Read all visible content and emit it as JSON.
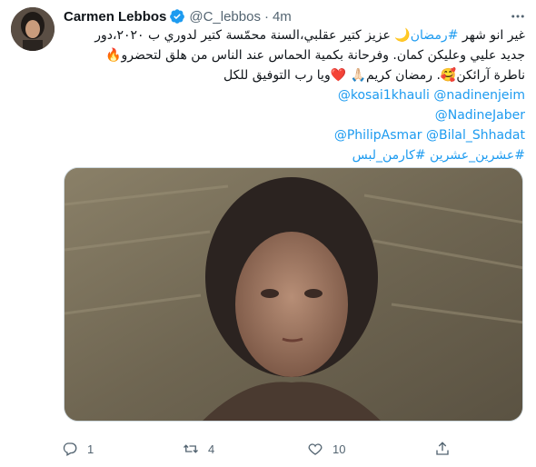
{
  "author": {
    "display_name": "Carmen Lebbos",
    "handle": "@C_lebbos",
    "separator": "·",
    "time": "4m",
    "verified_icon": "verified-badge-icon",
    "accent": "#1d9bf0"
  },
  "tweet": {
    "line1_text": "غير انو شهر ",
    "line1_hashtag": "#رمضان",
    "line1_rest": "🌙 عزيز كتير عقلبي،السنة محمّسة كتير لدوري ب ٢٠٢٠،دور",
    "line2": "جديد عليي وعليكن كمان. وفرحانة بكمية الحماس عند الناس من هلق لتحضرو🔥",
    "line3": "ناطرة آرائكن🥰. رمضان كريم🙏🏻 ❤️ويا رب التوفيق للكل",
    "mentions_line1": "@kosai1khauli @nadinenjeim",
    "mentions_line2": "@NadineJaber",
    "mentions_line3": "@PhilipAsmar @Bilal_Shhadat",
    "hashtags_line": "#عشرين_عشرين #كارمن_لبس"
  },
  "actions": {
    "reply_count": "1",
    "retweet_count": "4",
    "like_count": "10",
    "reply_icon": "reply-icon",
    "retweet_icon": "retweet-icon",
    "like_icon": "heart-icon",
    "share_icon": "share-icon"
  }
}
